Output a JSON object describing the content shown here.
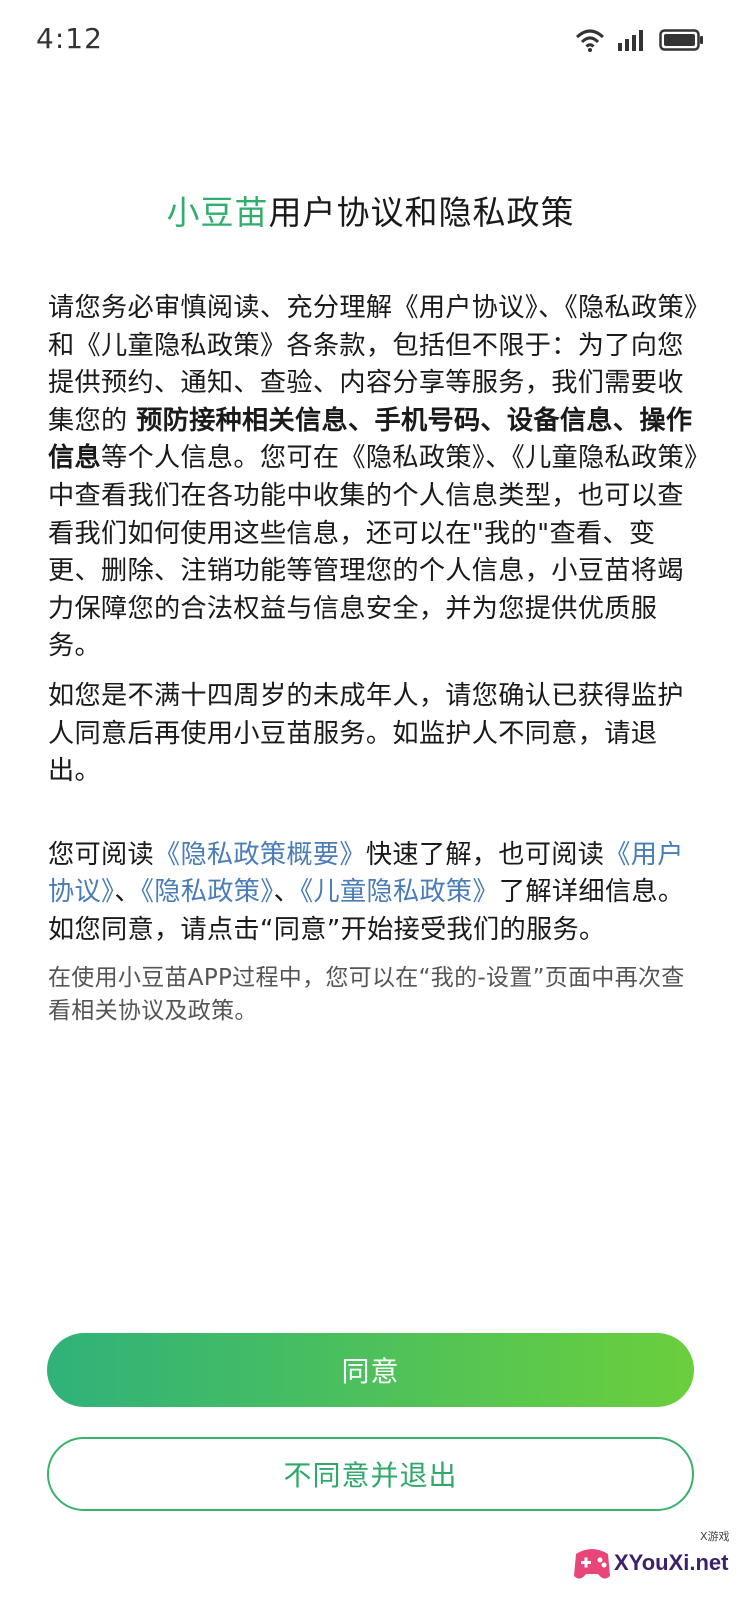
{
  "status_bar": {
    "time": "4:12",
    "icons": [
      "wifi-icon",
      "signal-icon",
      "battery-icon"
    ]
  },
  "title": {
    "brand": "小豆苗",
    "rest": "用户协议和隐私政策"
  },
  "paragraph1": {
    "part1": "请您务必审慎阅读、充分理解《用户协议》、《隐私政策》和《儿童隐私政策》各条款，包括但不限于：为了向您提供预约、通知、查验、内容分享等服务，我们需要收集您的 ",
    "bold": "预防接种相关信息、手机号码、设备信息、操作信息",
    "part2": "等个人信息。您可在《隐私政策》、《儿童隐私政策》中查看我们在各功能中收集的个人信息类型，也可以查看我们如何使用这些信息，还可以在\"我的\"查看、变更、删除、注销功能等管理您的个人信息，小豆苗将竭力保障您的合法权益与信息安全，并为您提供优质服务。"
  },
  "paragraph2": "如您是不满十四周岁的未成年人，请您确认已获得监护人同意后再使用小豆苗服务。如监护人不同意，请退出。",
  "paragraph3": {
    "prefix": "您可阅读",
    "link_summary": "《隐私政策概要》",
    "middle": "快速了解，也可阅读",
    "link_user_agreement": "《用户协议》",
    "sep1": "、",
    "link_privacy": "《隐私政策》",
    "sep2": "、",
    "link_child_privacy": "《儿童隐私政策》",
    "suffix": "了解详细信息。如您同意，请点击“同意”开始接受我们的服务。"
  },
  "note": "在使用小豆苗APP过程中，您可以在“我的-设置”页面中再次查看相关协议及政策。",
  "buttons": {
    "agree": "同意",
    "disagree": "不同意并退出"
  },
  "watermark": {
    "small": "X游戏",
    "text": "XYouXi.net"
  },
  "colors": {
    "brand_green": "#2fae6e",
    "link_blue": "#4a7db8",
    "gradient_start": "#2fb27a",
    "gradient_end": "#6bcf3c"
  }
}
